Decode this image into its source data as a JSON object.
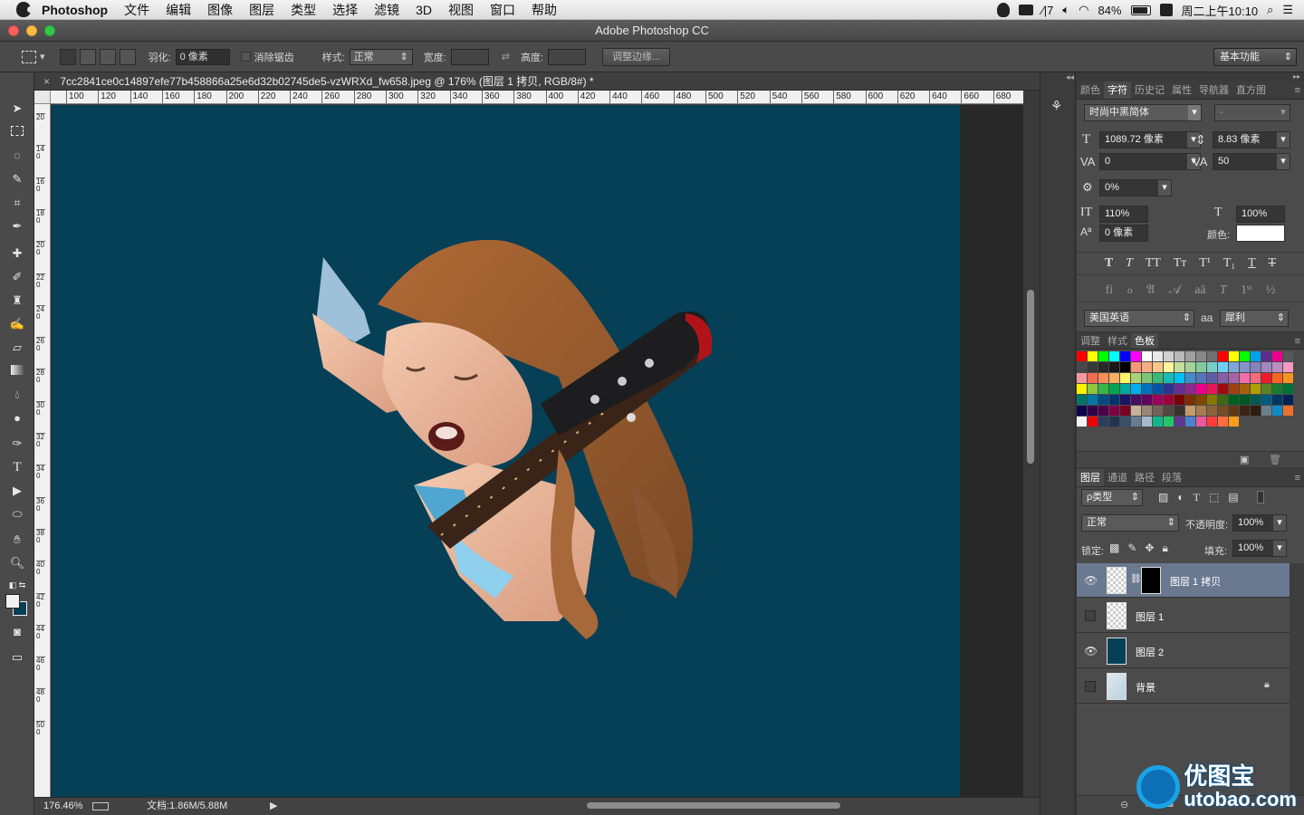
{
  "menubar": {
    "app_name": "Photoshop",
    "items": [
      "文件",
      "编辑",
      "图像",
      "图层",
      "类型",
      "选择",
      "滤镜",
      "3D",
      "视图",
      "窗口",
      "帮助"
    ],
    "status": {
      "input_method": "7",
      "battery": "84%",
      "clock": "周二上午10:10"
    }
  },
  "window": {
    "title": "Adobe Photoshop CC"
  },
  "options_bar": {
    "feather_label": "羽化:",
    "feather_value": "0 像素",
    "antialias_label": "消除锯齿",
    "style_label": "样式:",
    "style_value": "正常",
    "width_label": "宽度:",
    "height_label": "高度:",
    "refine_edge": "调整边缘...",
    "workspace": "基本功能"
  },
  "document": {
    "tab_title": "7cc2841ce0c14897efe77b458866a25e6d32b02745de5-vzWRXd_fw658.jpeg @ 176% (图层 1 拷贝, RGB/8#) *",
    "zoom": "176.46%",
    "doc_size": "文档:1.86M/5.88M",
    "canvas_color": "#064057",
    "ruler_h": [
      "100",
      "120",
      "140",
      "160",
      "180",
      "200",
      "220",
      "240",
      "260",
      "280",
      "300",
      "320",
      "340",
      "360",
      "380",
      "400",
      "420",
      "440",
      "460",
      "480",
      "500",
      "520",
      "540",
      "560",
      "580",
      "600",
      "620",
      "640",
      "660",
      "680"
    ],
    "ruler_v": [
      "2 0",
      "1 4 0",
      "1 6 0",
      "1 8 0",
      "2 0 0",
      "2 2 0",
      "2 4 0",
      "2 6 0",
      "2 8 0",
      "3 0 0",
      "3 2 0",
      "3 4 0",
      "3 6 0",
      "3 8 0",
      "4 0 0",
      "4 2 0",
      "4 4 0",
      "4 6 0",
      "4 8 0",
      "5 0 0"
    ]
  },
  "char_panel": {
    "tabs": [
      "颜色",
      "字符",
      "历史记",
      "属性",
      "导航器",
      "直方图"
    ],
    "font_family": "时尚中黑简体",
    "font_style": "-",
    "font_size": "1089.72 像素",
    "leading": "8.83 像素",
    "kerning": "0",
    "tracking": "50",
    "tsume": "0%",
    "vscale": "110%",
    "hscale": "100%",
    "baseline": "0 像素",
    "color_label": "颜色:",
    "language": "美国英语",
    "aa_label": "aa",
    "antialias": "犀利"
  },
  "swatch_panel": {
    "tabs": [
      "调整",
      "样式",
      "色板"
    ],
    "colors": [
      "#ff0000",
      "#ffff00",
      "#00ff00",
      "#00ffff",
      "#0000ff",
      "#ff00ff",
      "#ffffff",
      "#e8e8e8",
      "#d0d0d0",
      "#b8b8b8",
      "#a0a0a0",
      "#888888",
      "#707070",
      "#ff0000",
      "#ffff00",
      "#00ff00",
      "#00a0e9",
      "#5b2d8c",
      "#ec008c",
      "#585858",
      "#484848",
      "#383838",
      "#282828",
      "#181818",
      "#000000",
      "#f7977a",
      "#fbad82",
      "#fdc68a",
      "#fff79a",
      "#c4df9b",
      "#a2d39c",
      "#82ca9d",
      "#7bcdc8",
      "#6ecff6",
      "#7ea7d8",
      "#8493ca",
      "#8882be",
      "#a187be",
      "#bc8dbf",
      "#f49ac2",
      "#f6989d",
      "#f26c4f",
      "#f68e55",
      "#fbaf5d",
      "#fff467",
      "#acd372",
      "#7cc576",
      "#3bb878",
      "#1abbb4",
      "#00bff3",
      "#438cca",
      "#5574b9",
      "#605ca8",
      "#855fa8",
      "#a763a8",
      "#f06ea9",
      "#f26d7d",
      "#ed1c24",
      "#f26522",
      "#f7941d",
      "#fff200",
      "#8dc63f",
      "#39b54a",
      "#00a651",
      "#00a99d",
      "#00aeef",
      "#0072bc",
      "#0054a6",
      "#2e3192",
      "#662d91",
      "#92278f",
      "#ec008c",
      "#ed145b",
      "#9e0b0f",
      "#a0410d",
      "#a36209",
      "#aba000",
      "#598527",
      "#197b30",
      "#007236",
      "#00746b",
      "#0076a3",
      "#004b80",
      "#003471",
      "#1b1464",
      "#440e62",
      "#630460",
      "#9e005d",
      "#9e0039",
      "#790000",
      "#7b2e00",
      "#7d4900",
      "#827b00",
      "#406618",
      "#005e20",
      "#005826",
      "#005952",
      "#005b7f",
      "#003663",
      "#002157",
      "#0d004c",
      "#32004b",
      "#4b0049",
      "#7b0046",
      "#7a0026",
      "#c7b299",
      "#998675",
      "#736357",
      "#534741",
      "#37302d",
      "#c69c6d",
      "#a67c52",
      "#8c6239",
      "#754c24",
      "#603913",
      "#3c2415",
      "#2e1d0f",
      "#6c7e89",
      "#0f8ac6",
      "#ec6f2f",
      "#f4f4f4",
      "#ee0000",
      "#2e3d5d",
      "#22344f",
      "#3b4f6b",
      "#677c93",
      "#a9b9c9",
      "#14b58b",
      "#25c66b",
      "#5d3a8e",
      "#4e7fd1",
      "#e85a9c",
      "#ff3c3c",
      "#ff6f3c",
      "#ff9c1a"
    ]
  },
  "layers_panel": {
    "tabs": [
      "图层",
      "通道",
      "路径",
      "段落"
    ],
    "filter": "ρ类型",
    "blend_mode": "正常",
    "opacity_label": "不透明度:",
    "opacity": "100%",
    "lock_label": "锁定:",
    "fill_label": "填充:",
    "fill": "100%",
    "layers": [
      {
        "name": "图层 1 拷贝",
        "visible": true,
        "selected": true
      },
      {
        "name": "图层 1",
        "visible": false,
        "selected": false
      },
      {
        "name": "图层 2",
        "visible": true,
        "selected": false
      },
      {
        "name": "背景",
        "visible": false,
        "selected": false
      }
    ]
  },
  "watermark": {
    "cn": "优图宝",
    "en": "utobao.com"
  }
}
